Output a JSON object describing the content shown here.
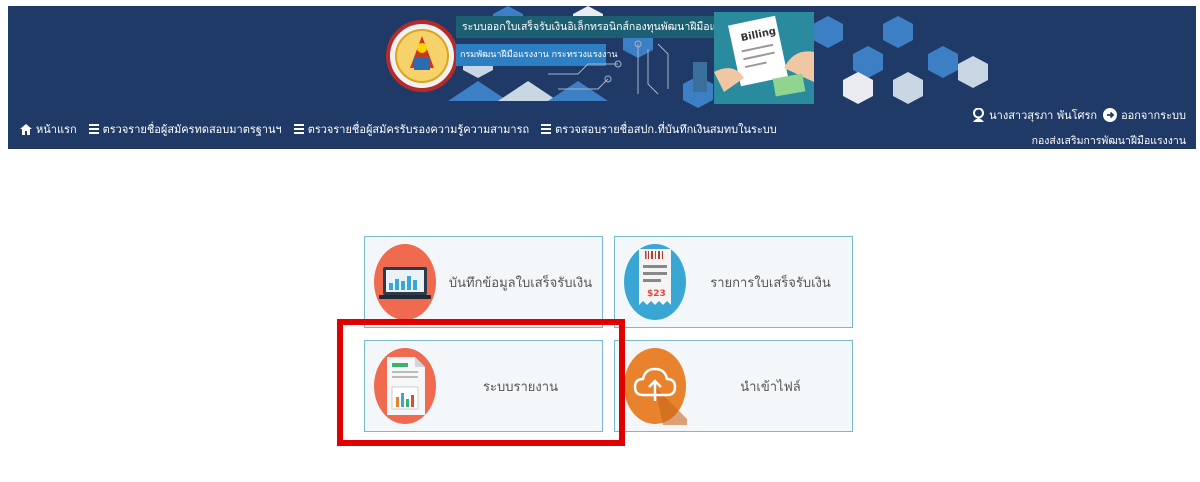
{
  "header": {
    "system_title": "ระบบออกใบเสร็จรับเงินอิเล็กทรอนิกส์กองทุนพัฒนาฝีมือแรงงาน",
    "department": "กรมพัฒนาฝีมือแรงงาน กระทรวงแรงงาน",
    "bill_text": "Billing",
    "nav": [
      {
        "label": "หน้าแรก",
        "icon": "home-icon"
      },
      {
        "label": "ตรวจรายชื่อผู้สมัครทดสอบมาตรฐานฯ",
        "icon": "list-icon"
      },
      {
        "label": "ตรวจรายชื่อผู้สมัครรับรองความรู้ความสามารถ",
        "icon": "list-icon"
      },
      {
        "label": "ตรวจสอบรายชื่อสปก.ที่บันทึกเงินสมทบในระบบ",
        "icon": "list-icon"
      }
    ],
    "user": {
      "name": "นางสาวสุรภา พันโศรก",
      "logout": "ออกจากระบบ",
      "org": "กองส่งเสริมการพัฒนาฝีมือแรงงาน"
    }
  },
  "cards": [
    {
      "label": "บันทึกข้อมูลใบเสร็จรับเงิน",
      "icon": "laptop-chart-icon",
      "color": "#ef6a4f"
    },
    {
      "label": "รายการใบเสร็จรับเงิน",
      "icon": "receipt-icon",
      "color": "#3aa6d4",
      "amount": "$23"
    },
    {
      "label": "ระบบรายงาน",
      "icon": "report-document-icon",
      "color": "#ef6a4f"
    },
    {
      "label": "นำเข้าไฟล์",
      "icon": "cloud-upload-icon",
      "color": "#e8822c"
    }
  ],
  "colors": {
    "header_bg": "#1f3a66",
    "card_border": "#79b9c9",
    "highlight": "#e00000"
  }
}
